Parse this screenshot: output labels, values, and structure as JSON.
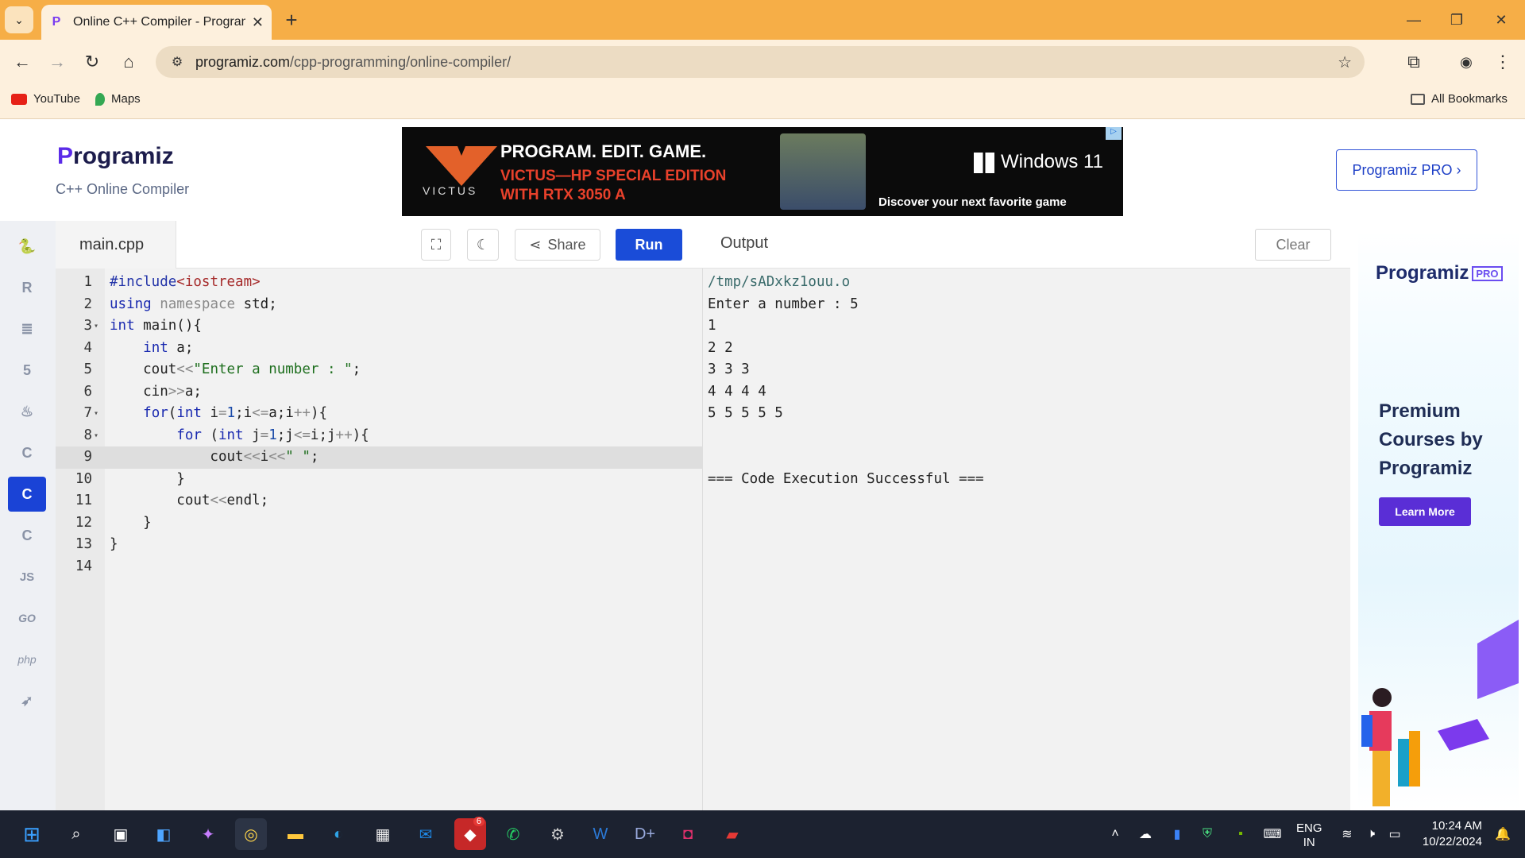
{
  "browser": {
    "tab_title": "Online C++ Compiler - Program",
    "url_domain": "programiz.com",
    "url_path": "/cpp-programming/online-compiler/",
    "bookmarks": [
      "YouTube",
      "Maps"
    ],
    "all_bookmarks": "All Bookmarks"
  },
  "header": {
    "logo_text": "rogramiz",
    "logo_letter": "P",
    "subtitle": "C++ Online Compiler",
    "pro_button": "Programiz PRO ›"
  },
  "ad_banner": {
    "headline": "PROGRAM. EDIT. GAME.",
    "subline": "VICTUS—HP SPECIAL EDITION WITH RTX 3050 A",
    "brand": "VICTUS",
    "windows": "Windows 11",
    "tagline": "Discover your next favorite game"
  },
  "sidebar": {
    "languages": [
      "python-icon",
      "r-icon",
      "sql-icon",
      "html-icon",
      "java-icon",
      "c-icon",
      "cpp-icon",
      "csharp-icon",
      "JS",
      "GO",
      "php",
      "swift-icon"
    ]
  },
  "editor": {
    "file_name": "main.cpp",
    "share_label": "Share",
    "run_label": "Run",
    "lines": [
      "#include<iostream>",
      "using namespace std;",
      "int main(){",
      "    int a;",
      "    cout<<\"Enter a number : \";",
      "    cin>>a;",
      "    for(int i=1;i<=a;i++){",
      "        for (int j=1;j<=i;j++){",
      "            cout<<i<<\" \";",
      "        }",
      "        cout<<endl;",
      "    }",
      "}",
      ""
    ],
    "line_numbers": [
      "1",
      "2",
      "3",
      "4",
      "5",
      "6",
      "7",
      "8",
      "9",
      "10",
      "11",
      "12",
      "13",
      "14"
    ]
  },
  "output": {
    "title": "Output",
    "clear_label": "Clear",
    "lines": [
      "/tmp/sADxkz1ouu.o",
      "Enter a number : 5",
      "1",
      "2 2",
      "3 3 3",
      "4 4 4 4",
      "5 5 5 5 5",
      "",
      "",
      "=== Code Execution Successful ==="
    ]
  },
  "side_ad": {
    "logo": "Programiz",
    "pro_tag": "PRO",
    "headline": "Premium Courses by Programiz",
    "button": "Learn More"
  },
  "taskbar": {
    "lang_top": "ENG",
    "lang_bottom": "IN",
    "time": "10:24 AM",
    "date": "10/22/2024",
    "badge": "6"
  }
}
